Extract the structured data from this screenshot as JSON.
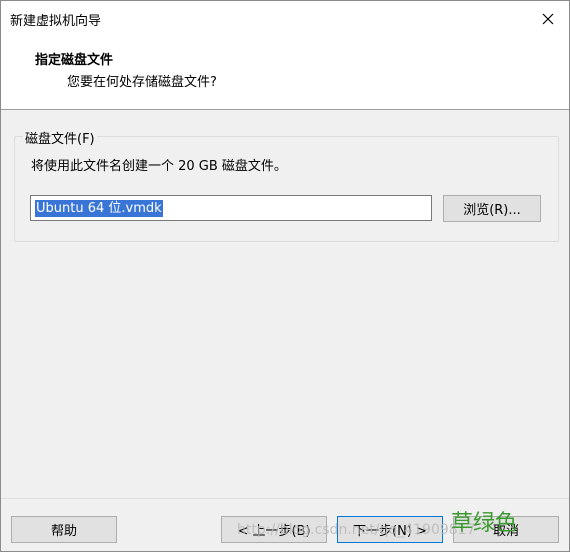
{
  "window": {
    "title": "新建虚拟机向导"
  },
  "header": {
    "title": "指定磁盘文件",
    "subtitle": "您要在何处存储磁盘文件?"
  },
  "disk_group": {
    "label": "磁盘文件(F)",
    "description": "将使用此文件名创建一个 20 GB 磁盘文件。",
    "file_value": "Ubuntu 64 位.vmdk",
    "browse_label": "浏览(R)..."
  },
  "footer": {
    "help_label": "帮助",
    "back_label": "< 上一步(B)",
    "next_label": "下一步(N) >",
    "cancel_label": "取消"
  },
  "watermarks": {
    "overlay_text": "草绿色",
    "url_text": "http://blog.csdn.net/qq_41909817"
  },
  "colors": {
    "selection": "#3875d7",
    "focus_border": "#0078d7",
    "watermark_green": "#3a9a2e"
  }
}
